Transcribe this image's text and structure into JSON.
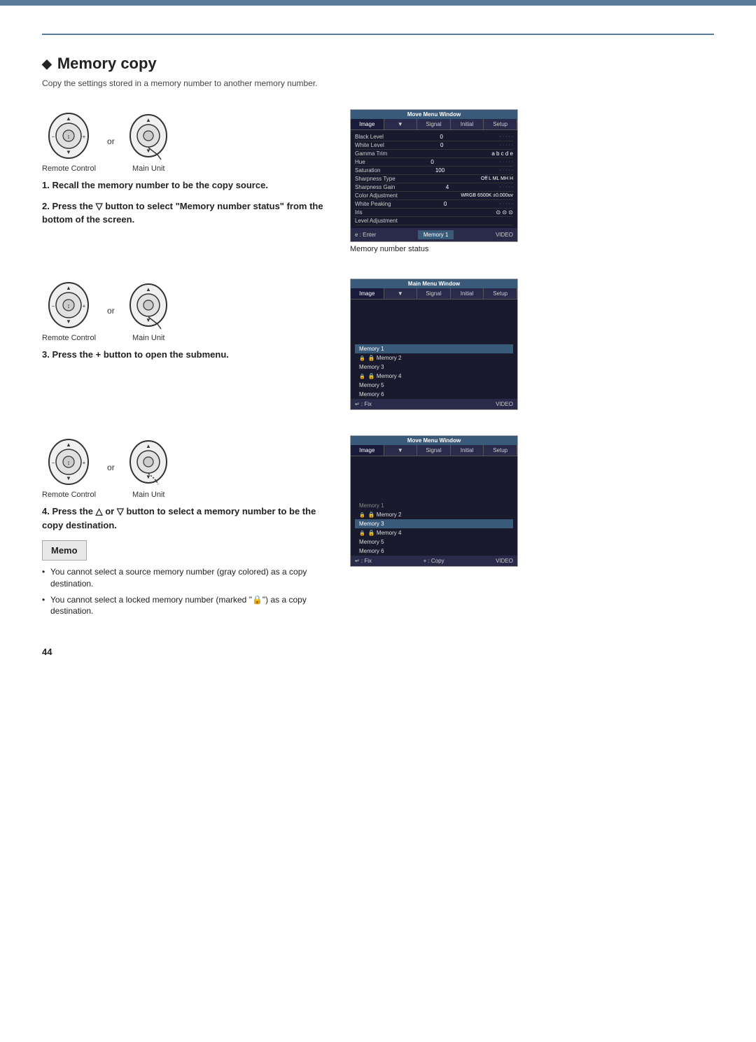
{
  "page": {
    "top_bar_color": "#5a7a9a",
    "title_diamond": "◆",
    "title": "Memory copy",
    "subtitle": "Copy the settings stored in a memory number to another memory number.",
    "page_number": "44"
  },
  "steps": [
    {
      "number": "1.",
      "instruction": "Recall the memory number to be the copy source."
    },
    {
      "number": "2.",
      "instruction": "Press the ▽ button to select \"Memory number status\" from the bottom of the screen."
    },
    {
      "number": "3.",
      "instruction": "Press the + button to open the submenu."
    },
    {
      "number": "4.",
      "instruction": "Press the △ or ▽ button to select a memory number to be the copy destination."
    }
  ],
  "controls": {
    "remote_label": "Remote Control",
    "main_unit_label": "Main Unit",
    "or_text": "or"
  },
  "screen1": {
    "title": "Move Menu Window",
    "tabs": [
      "Image",
      "▼",
      "Signal",
      "Initial",
      "Setup"
    ],
    "rows": [
      {
        "label": "Black Level",
        "value": "0"
      },
      {
        "label": "White Level",
        "value": "0"
      },
      {
        "label": "Gamma Trim",
        "value": "a  b  c  d  e"
      },
      {
        "label": "Hue",
        "value": "0"
      },
      {
        "label": "Saturation",
        "value": "100"
      },
      {
        "label": "Sharpness Type",
        "value": "Off  L  ML  MH  H"
      },
      {
        "label": "Sharpness Gain",
        "value": "4"
      },
      {
        "label": "Color Adjustment",
        "value": "WRGB  6500K ±0.000uv"
      },
      {
        "label": "White Peaking",
        "value": "0"
      },
      {
        "label": "Iris",
        "value": "⊙  ⊙  ⊙"
      },
      {
        "label": "Level Adjustment",
        "value": ""
      }
    ],
    "footer_left": "e : Enter",
    "footer_memory": "Memory 1",
    "footer_right": "VIDEO",
    "caption": "Memory number status"
  },
  "screen2": {
    "title": "Main Menu Window",
    "tabs": [
      "Image",
      "▼",
      "Signal",
      "Initial",
      "Setup"
    ],
    "memory_items": [
      {
        "name": "Memory 1",
        "selected": true,
        "locked": false
      },
      {
        "name": "Memory 2",
        "selected": false,
        "locked": true
      },
      {
        "name": "Memory 3",
        "selected": false,
        "locked": false
      },
      {
        "name": "Memory 4",
        "selected": false,
        "locked": true
      },
      {
        "name": "Memory 5",
        "selected": false,
        "locked": false
      },
      {
        "name": "Memory 6",
        "selected": false,
        "locked": false
      }
    ],
    "footer_left": "↵ : Fix",
    "footer_right": "VIDEO"
  },
  "screen3": {
    "title": "Move Menu Window",
    "tabs": [
      "Image",
      "▼",
      "Signal",
      "Initial",
      "Setup"
    ],
    "memory_items": [
      {
        "name": "Memory 1",
        "selected": false,
        "locked": false,
        "source": true
      },
      {
        "name": "Memory 2",
        "selected": false,
        "locked": true
      },
      {
        "name": "Memory 3",
        "selected": true,
        "locked": false
      },
      {
        "name": "Memory 4",
        "selected": false,
        "locked": true
      },
      {
        "name": "Memory 5",
        "selected": false,
        "locked": false
      },
      {
        "name": "Memory 6",
        "selected": false,
        "locked": false
      }
    ],
    "footer_left": "↵ : Fix",
    "footer_middle": "+ : Copy",
    "footer_right": "VIDEO"
  },
  "memo": {
    "label": "Memo",
    "bullets": [
      "You cannot select a source memory number (gray colored) as a copy destination.",
      "You cannot select a locked memory number (marked \"🔒\") as a copy destination."
    ]
  }
}
